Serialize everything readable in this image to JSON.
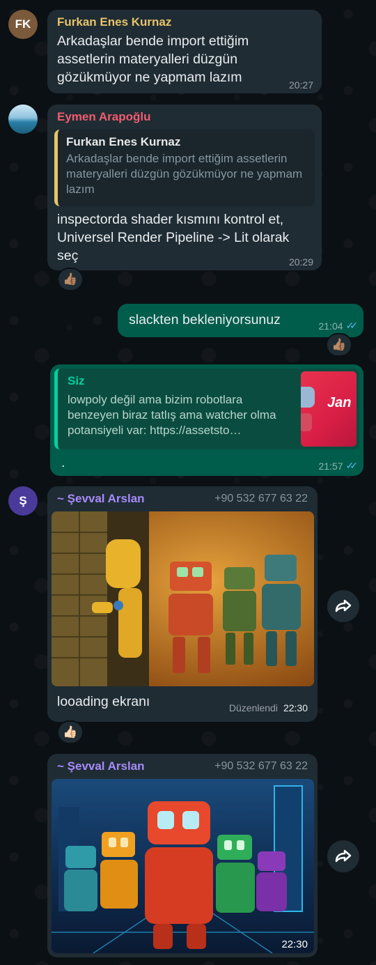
{
  "messages": {
    "m1": {
      "avatar_text": "FK",
      "sender": "Furkan Enes Kurnaz",
      "text": "Arkadaşlar bende import ettiğim assetlerin materyalleri düzgün gözükmüyor ne yapmam lazım",
      "time": "20:27"
    },
    "m2": {
      "sender": "Eymen Arapoğlu",
      "quote_sender": "Furkan Enes Kurnaz",
      "quote_text": "Arkadaşlar bende import ettiğim assetlerin materyalleri düzgün gözükmüyor ne yapmam lazım",
      "text": "inspectorda shader kısmını kontrol et, Universel Render Pipeline -> Lit olarak seç",
      "time": "20:29",
      "reaction": "👍🏽"
    },
    "m3": {
      "text": "slackten bekleniyorsunuz",
      "time": "21:04",
      "reaction": "👍🏽"
    },
    "m4": {
      "quote_sender": "Siz",
      "quote_text": "lowpoly değil ama bizim robotlara benzeyen biraz tatlış ama watcher olma potansiyeli var: https://assetsto…",
      "thumb_text": "Jan",
      "text": ".",
      "time": "21:57"
    },
    "m5": {
      "avatar_text": "Ş",
      "sender": "~ Şevval Arslan",
      "phone": "+90 532 677 63 22",
      "caption": "looading ekranı",
      "edited": "Düzenlendi",
      "time": "22:30",
      "reaction": "👍🏻"
    },
    "m6": {
      "sender": "~ Şevval Arslan",
      "phone": "+90 532 677 63 22",
      "time": "22:30"
    }
  },
  "colors": {
    "incoming_bubble": "#1f2c34",
    "outgoing_bubble": "#005c4b",
    "furkan_name": "#e8c36a",
    "eymen_name": "#f15c6d",
    "sevval_name": "#a78bfa",
    "read_tick": "#53bdeb"
  }
}
